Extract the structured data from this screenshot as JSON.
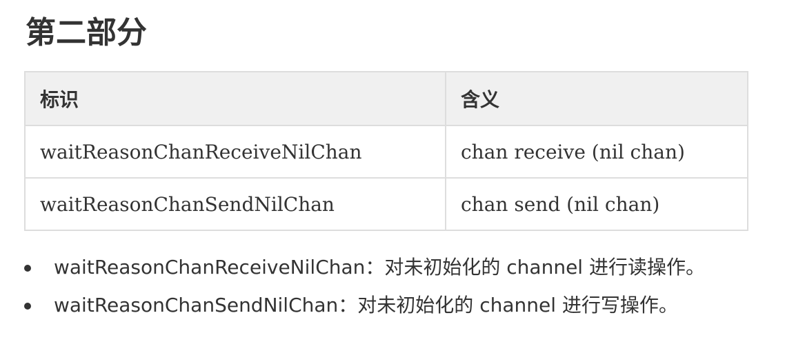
{
  "section": {
    "title": "第二部分"
  },
  "table": {
    "headers": [
      "标识",
      "含义"
    ],
    "rows": [
      [
        "waitReasonChanReceiveNilChan",
        "chan receive (nil chan)"
      ],
      [
        "waitReasonChanSendNilChan",
        "chan send (nil chan)"
      ]
    ]
  },
  "notes": [
    "waitReasonChanReceiveNilChan：对未初始化的 channel 进行读操作。",
    "waitReasonChanSendNilChan：对未初始化的 channel 进行写操作。"
  ]
}
